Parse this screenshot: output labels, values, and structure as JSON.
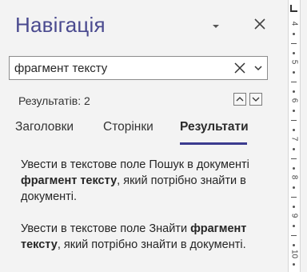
{
  "pane": {
    "title": "Навігація",
    "dropdown_icon": "chevron-down-icon",
    "close_icon": "close-icon"
  },
  "search": {
    "value": "фрагмент тексту",
    "clear_icon": "close-icon",
    "options_icon": "chevron-down-icon"
  },
  "results": {
    "count_label": "Результатів: 2",
    "prev_icon": "chevron-up-icon",
    "next_icon": "chevron-down-icon"
  },
  "tabs": [
    {
      "label": "Заголовки",
      "active": false
    },
    {
      "label": "Сторінки",
      "active": false
    },
    {
      "label": "Результати",
      "active": true
    }
  ],
  "items": [
    {
      "pre": "Увести в текстове поле Пошук в документі ",
      "match": "фрагмент тексту",
      "post": ", який потрібно знайти в документі."
    },
    {
      "pre": "Увести в текстове поле Знайти ",
      "match": "фрагмент тексту",
      "post": ", який потрібно знайти в документі."
    }
  ],
  "ruler": {
    "numbers": [
      "4",
      "5",
      "6",
      "7",
      "8",
      "9",
      "10"
    ]
  },
  "colors": {
    "accent": "#3b3b8f",
    "title": "#4a4a8f"
  }
}
